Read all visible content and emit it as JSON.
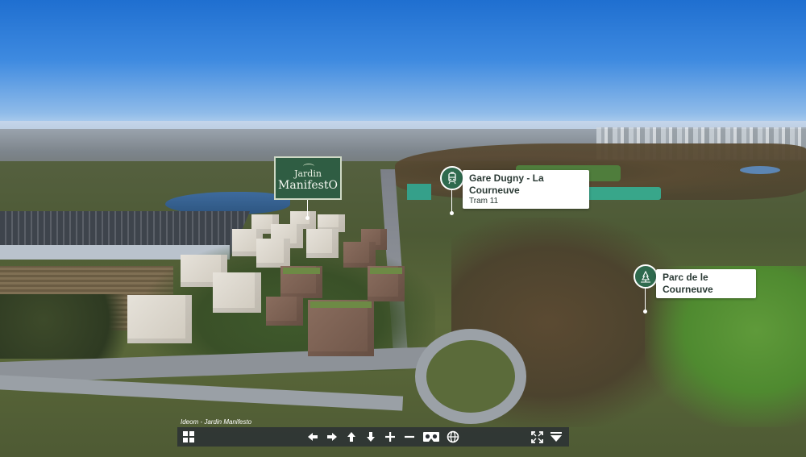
{
  "viewer": {
    "caption": "Ideom - Jardin Manifesto"
  },
  "logo": {
    "line1": "Jardin",
    "line2": "ManifestO"
  },
  "hotspots": [
    {
      "title": "Gare Dugny - La Courneuve",
      "subtitle": "Tram 11",
      "icon": "tram-icon"
    },
    {
      "title": "Parc de le Courneuve",
      "icon": "park-icon"
    }
  ],
  "toolbar": {
    "buttons": [
      {
        "name": "thumbnails-button",
        "icon": "grid-icon"
      },
      {
        "name": "pan-left-button",
        "icon": "arrow-left-icon"
      },
      {
        "name": "pan-right-button",
        "icon": "arrow-right-icon"
      },
      {
        "name": "pan-up-button",
        "icon": "arrow-up-icon"
      },
      {
        "name": "pan-down-button",
        "icon": "arrow-down-icon"
      },
      {
        "name": "zoom-in-button",
        "icon": "plus-icon"
      },
      {
        "name": "zoom-out-button",
        "icon": "minus-icon"
      },
      {
        "name": "vr-mode-button",
        "icon": "vr-headset-icon"
      },
      {
        "name": "gyroscope-button",
        "icon": "gyroscope-icon"
      },
      {
        "name": "fullscreen-button",
        "icon": "fullscreen-icon"
      },
      {
        "name": "hide-controls-button",
        "icon": "collapse-down-icon"
      }
    ],
    "color": "#282d34"
  },
  "colors": {
    "accent": "#2f6a4e",
    "logo_bg": "#2f5d43"
  }
}
